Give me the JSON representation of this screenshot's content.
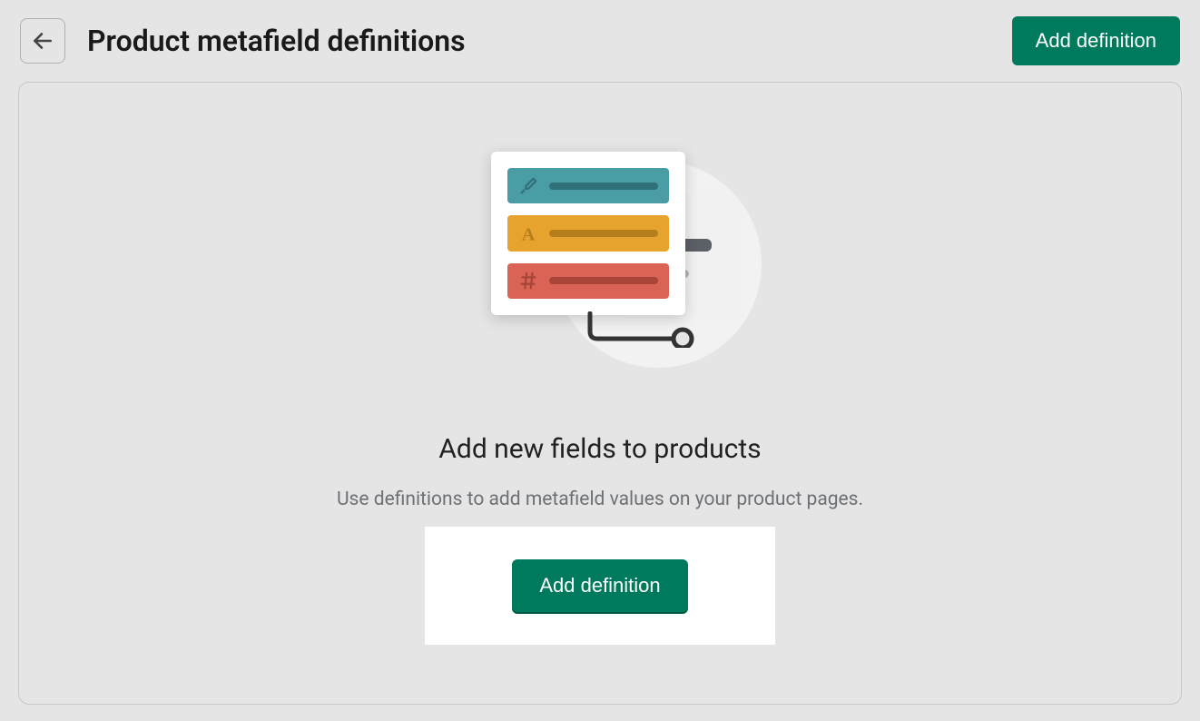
{
  "header": {
    "page_title": "Product metafield definitions",
    "add_button_label": "Add definition"
  },
  "empty_state": {
    "heading": "Add new fields to products",
    "description": "Use definitions to add metafield values on your product pages.",
    "cta_label": "Add definition"
  }
}
